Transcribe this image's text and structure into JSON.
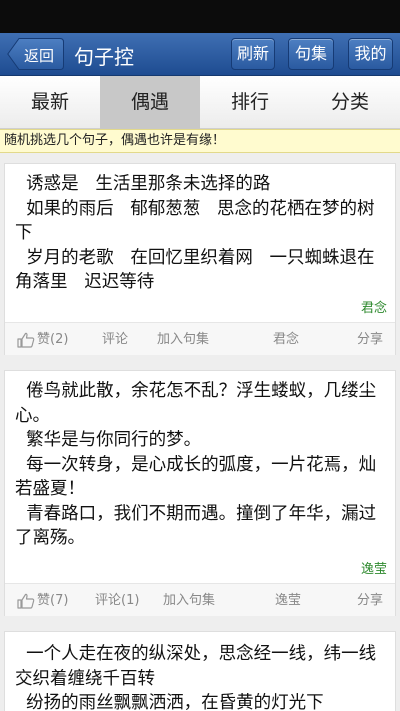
{
  "header": {
    "back_label": "返回",
    "title": "句子控",
    "buttons": [
      "刷新",
      "句集",
      "我的"
    ]
  },
  "tabs": [
    {
      "label": "最新",
      "active": false
    },
    {
      "label": "偶遇",
      "active": true
    },
    {
      "label": "排行",
      "active": false
    },
    {
      "label": "分类",
      "active": false
    }
  ],
  "notice": "随机挑选几个句子，偶遇也许是有缘！",
  "posts": [
    {
      "text": "  诱惑是   生活里那条未选择的路\n  如果的雨后   郁郁葱葱   思念的花栖在梦的树下\n  岁月的老歌   在回忆里织着网   一只蜘蛛退在角落里   迟迟等待",
      "author": "君念",
      "footer": {
        "like": "赞(2)",
        "comment": "评论",
        "add": "加入句集",
        "source": "君念",
        "share": "分享"
      }
    },
    {
      "text": "  倦鸟就此散，余花怎不乱？浮生蝼蚁，几缕尘心。\n  繁华是与你同行的梦。\n  每一次转身，是心成长的弧度，一片花焉，灿若盛夏！\n  青春路口，我们不期而遇。撞倒了年华，漏过了离殇。",
      "author": "逸莹",
      "footer": {
        "like": "赞(7)",
        "comment": "评论(1)",
        "add": "加入句集",
        "source": "逸莹",
        "share": "分享"
      }
    },
    {
      "text": "  一个人走在夜的纵深处，思念经一线，纬一线交织着缠绕千百转\n  纷扬的雨丝飘飘洒洒，在昏黄的灯光下"
    }
  ]
}
